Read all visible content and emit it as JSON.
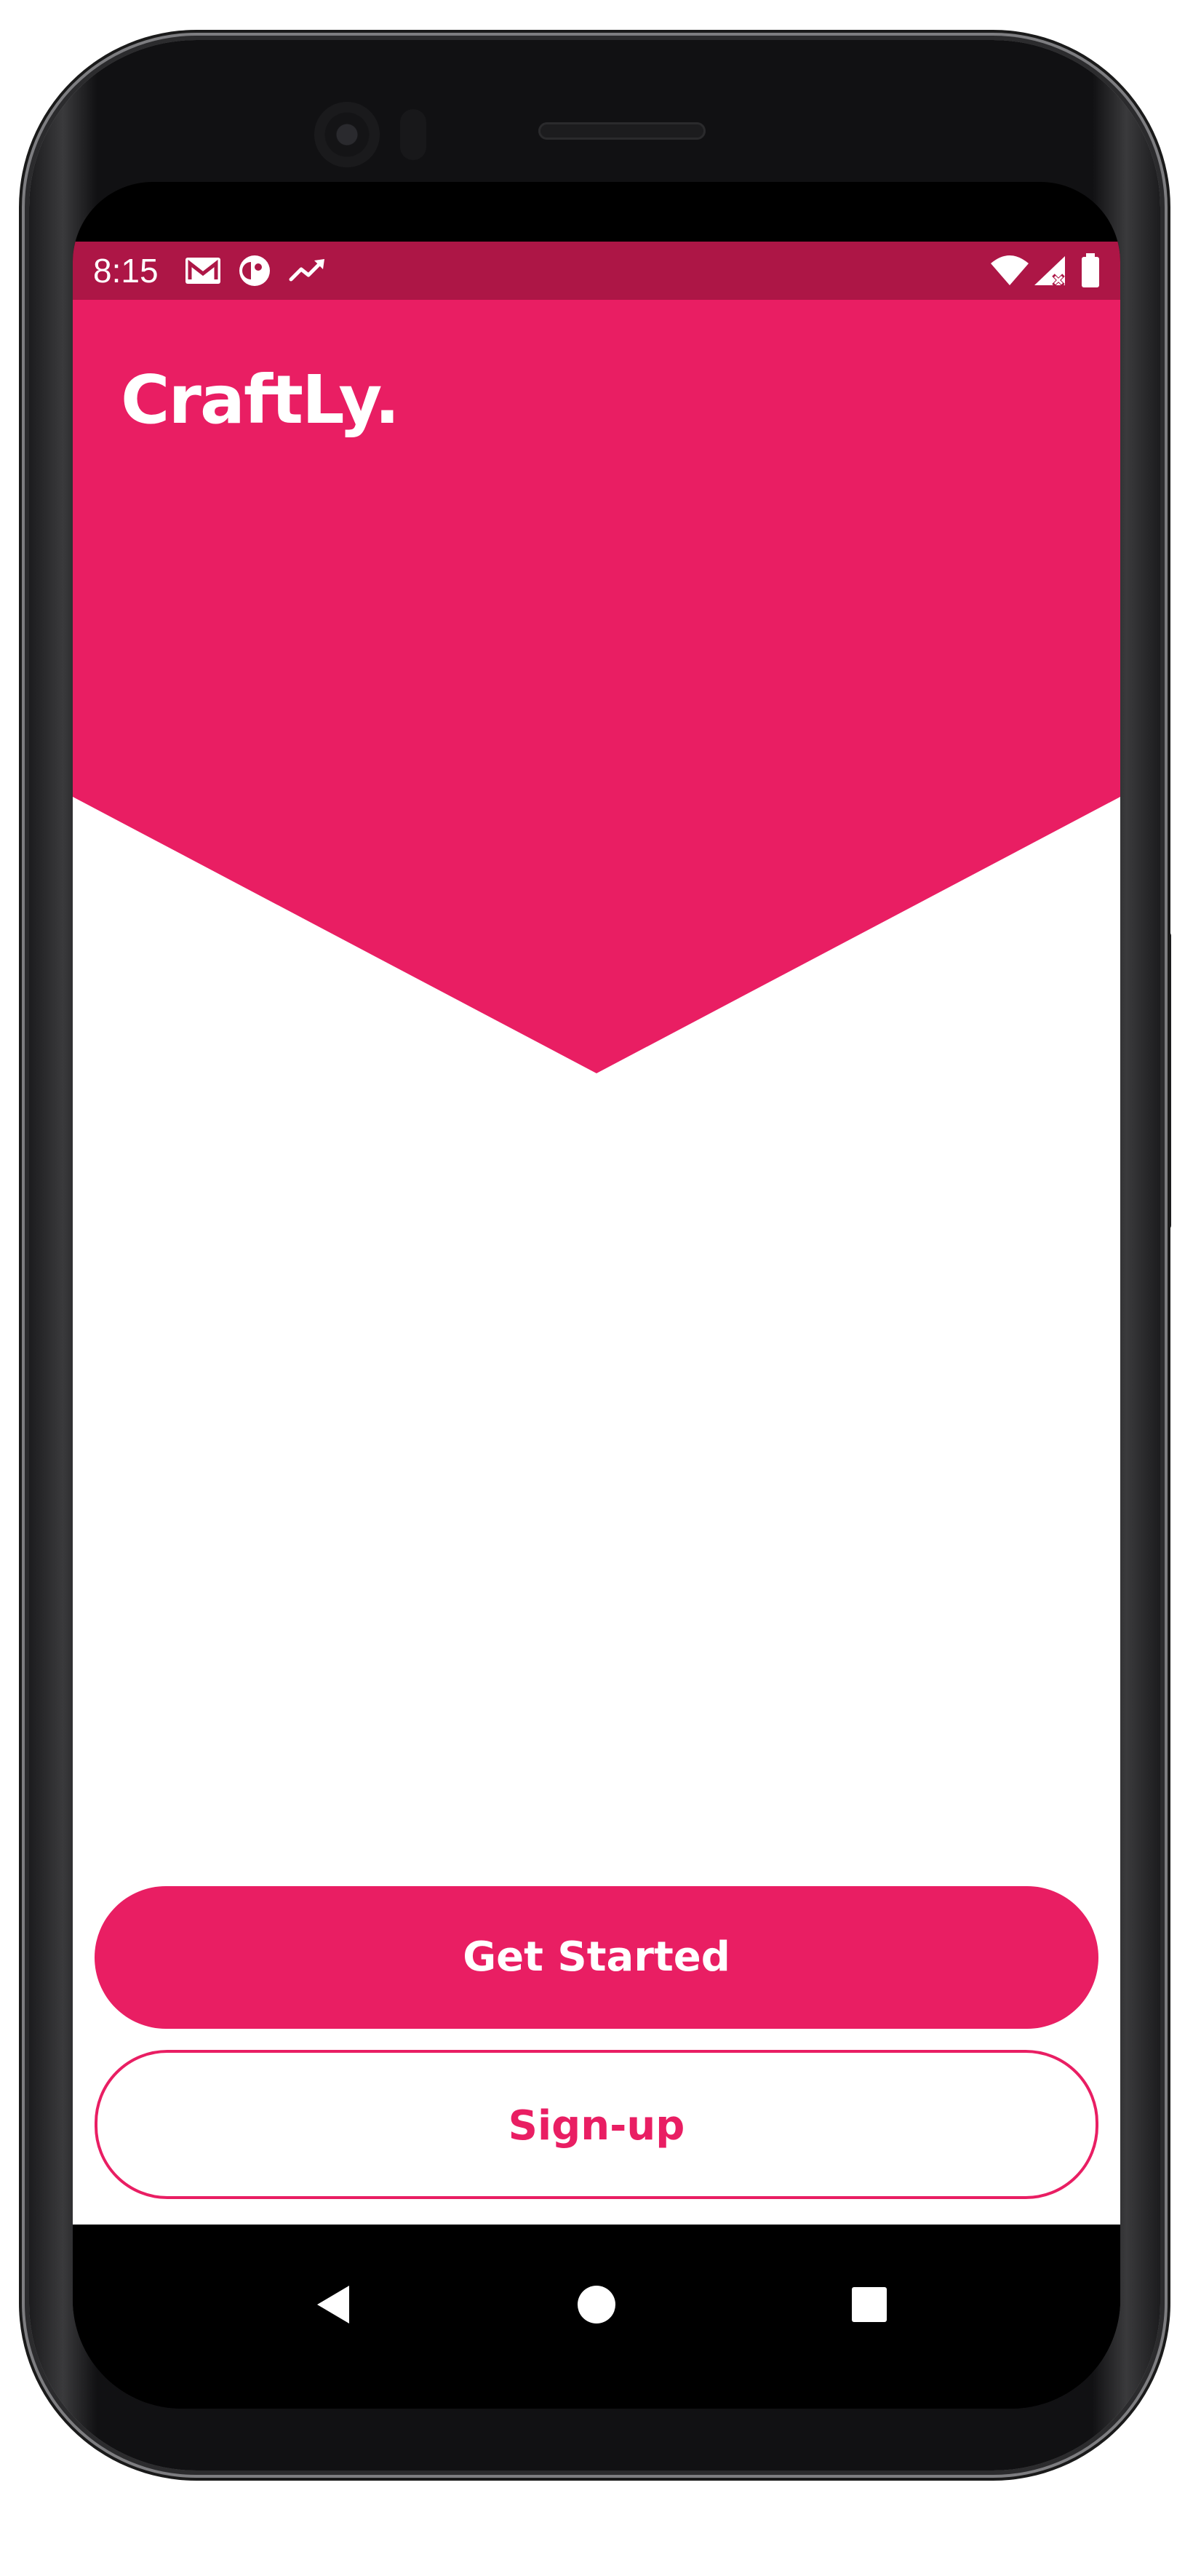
{
  "status_bar": {
    "time": "8:15",
    "background": "#ad1646",
    "left_icons": [
      "gmail-icon",
      "app-notification-icon",
      "trending-icon"
    ],
    "right_icons": [
      "wifi-icon",
      "cellular-no-data-icon",
      "battery-icon"
    ]
  },
  "app": {
    "brand": "CraftLy.",
    "accent_color": "#e91e63",
    "background": "#ffffff"
  },
  "buttons": {
    "get_started": "Get Started",
    "sign_up": "Sign-up"
  },
  "navigation": {
    "back": "back-icon",
    "home": "home-icon",
    "recents": "recents-icon"
  }
}
